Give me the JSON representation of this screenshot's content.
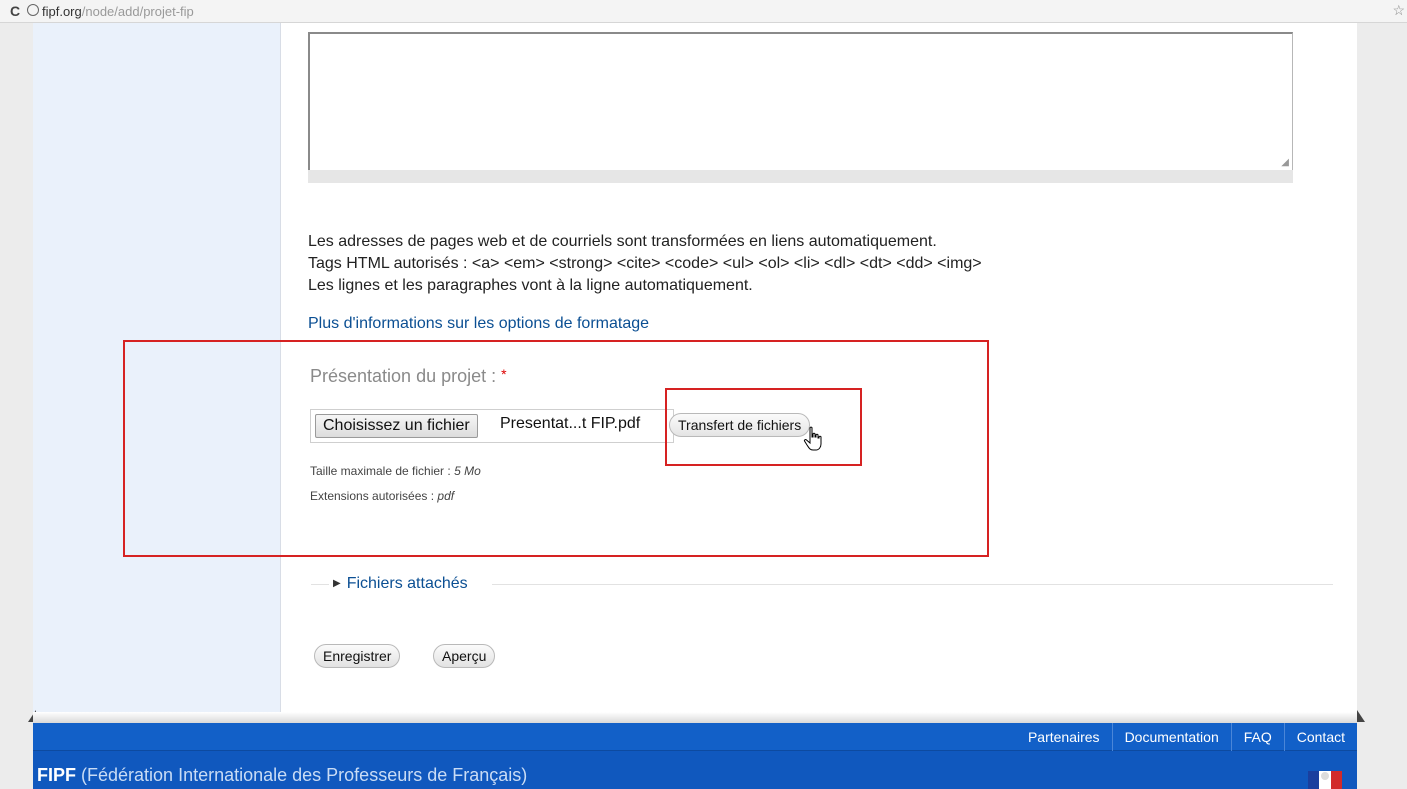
{
  "browser": {
    "url_host": "fipf.org",
    "url_path": "/node/add/projet-fip"
  },
  "help": {
    "line1": "Les adresses de pages web et de courriels sont transformées en liens automatiquement.",
    "line2": "Tags HTML autorisés : <a> <em> <strong> <cite> <code> <ul> <ol> <li> <dl> <dt> <dd> <img>",
    "line3": "Les lignes et les paragraphes vont à la ligne automatiquement.",
    "format_link": "Plus d'informations sur les options de formatage"
  },
  "file_field": {
    "label": "Présentation du projet :",
    "required_mark": "*",
    "choose_button": "Choisissez un fichier",
    "filename": "Presentat...t FIP.pdf",
    "upload_button": "Transfert de fichiers",
    "max_size_label": "Taille maximale de fichier :",
    "max_size_value": "5 Mo",
    "extensions_label": "Extensions autorisées :",
    "extensions_value": "pdf"
  },
  "attachments": {
    "legend": "Fichiers attachés"
  },
  "actions": {
    "save": "Enregistrer",
    "preview": "Aperçu"
  },
  "footer": {
    "links": [
      "Partenaires",
      "Documentation",
      "FAQ",
      "Contact"
    ],
    "org_abbr": "FIPF",
    "org_name": "(Fédération Internationale des Professeurs de Français)"
  },
  "colors": {
    "link": "#0b4f93",
    "footer_blue": "#1260c8",
    "annotation_red": "#d62222"
  }
}
